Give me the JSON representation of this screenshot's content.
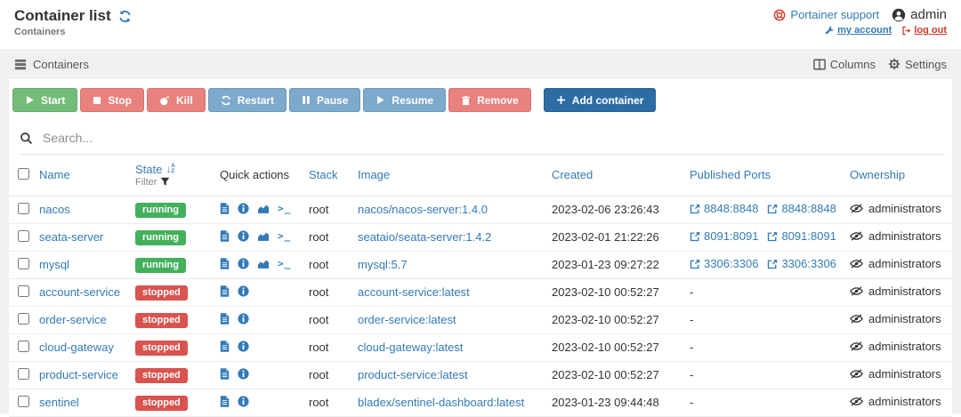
{
  "page": {
    "title": "Container list",
    "breadcrumb": "Containers",
    "header_right": {
      "support_label": "Portainer support",
      "username": "admin",
      "my_account_label": "my account",
      "log_out_label": "log out"
    }
  },
  "widget": {
    "title": "Containers",
    "columns_label": "Columns",
    "settings_label": "Settings"
  },
  "toolbar": {
    "buttons": [
      {
        "label": "Start",
        "style": "success",
        "icon": "play-icon"
      },
      {
        "label": "Stop",
        "style": "danger",
        "icon": "stop-icon"
      },
      {
        "label": "Kill",
        "style": "danger",
        "icon": "bomb-icon"
      },
      {
        "label": "Restart",
        "style": "info",
        "icon": "restart-icon"
      },
      {
        "label": "Pause",
        "style": "info",
        "icon": "pause-icon"
      },
      {
        "label": "Resume",
        "style": "info",
        "icon": "play-icon"
      },
      {
        "label": "Remove",
        "style": "danger",
        "icon": "trash-icon"
      },
      {
        "label": "Add container",
        "style": "primary",
        "icon": "plus-icon"
      }
    ]
  },
  "search": {
    "placeholder": "Search..."
  },
  "table": {
    "headers": {
      "name": "Name",
      "state": "State",
      "filter": "Filter",
      "quick_actions": "Quick actions",
      "stack": "Stack",
      "image": "Image",
      "created": "Created",
      "published_ports": "Published Ports",
      "ownership": "Ownership"
    },
    "empty_ports_placeholder": "-",
    "rows": [
      {
        "name": "nacos",
        "state": "running",
        "actions": [
          "logs",
          "inspect",
          "stats",
          "console"
        ],
        "stack": "root",
        "image": "nacos/nacos-server:1.4.0",
        "created": "2023-02-06 23:26:43",
        "ports": [
          "8848:8848",
          "8848:8848"
        ],
        "ownership": "administrators"
      },
      {
        "name": "seata-server",
        "state": "running",
        "actions": [
          "logs",
          "inspect",
          "stats",
          "console"
        ],
        "stack": "root",
        "image": "seataio/seata-server:1.4.2",
        "created": "2023-02-01 21:22:26",
        "ports": [
          "8091:8091",
          "8091:8091"
        ],
        "ownership": "administrators"
      },
      {
        "name": "mysql",
        "state": "running",
        "actions": [
          "logs",
          "inspect",
          "stats",
          "console"
        ],
        "stack": "root",
        "image": "mysql:5.7",
        "created": "2023-01-23 09:27:22",
        "ports": [
          "3306:3306",
          "3306:3306"
        ],
        "ownership": "administrators"
      },
      {
        "name": "account-service",
        "state": "stopped",
        "actions": [
          "logs",
          "inspect"
        ],
        "stack": "root",
        "image": "account-service:latest",
        "created": "2023-02-10 00:52:27",
        "ports": [],
        "ownership": "administrators"
      },
      {
        "name": "order-service",
        "state": "stopped",
        "actions": [
          "logs",
          "inspect"
        ],
        "stack": "root",
        "image": "order-service:latest",
        "created": "2023-02-10 00:52:27",
        "ports": [],
        "ownership": "administrators"
      },
      {
        "name": "cloud-gateway",
        "state": "stopped",
        "actions": [
          "logs",
          "inspect"
        ],
        "stack": "root",
        "image": "cloud-gateway:latest",
        "created": "2023-02-10 00:52:27",
        "ports": [],
        "ownership": "administrators"
      },
      {
        "name": "product-service",
        "state": "stopped",
        "actions": [
          "logs",
          "inspect"
        ],
        "stack": "root",
        "image": "product-service:latest",
        "created": "2023-02-10 00:52:27",
        "ports": [],
        "ownership": "administrators"
      },
      {
        "name": "sentinel",
        "state": "stopped",
        "actions": [
          "logs",
          "inspect"
        ],
        "stack": "root",
        "image": "bladex/sentinel-dashboard:latest",
        "created": "2023-01-23 09:44:48",
        "ports": [],
        "ownership": "administrators"
      }
    ]
  },
  "colors": {
    "link_blue": "#337ab7",
    "running_green": "#43b05c",
    "stopped_red": "#d9534f",
    "button_green": "#74bd78",
    "button_salmon": "#e8827e",
    "button_steel_blue": "#7da9cc",
    "button_primary_blue": "#2e6da4",
    "support_red": "#d9362b",
    "logout_red": "#c9392c"
  }
}
